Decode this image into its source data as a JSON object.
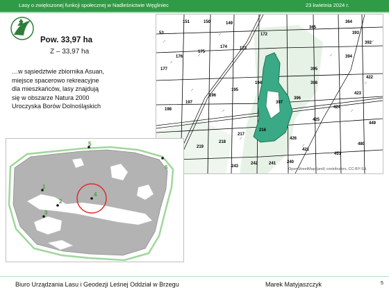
{
  "header": {
    "title": "Lasy o zwiększonej funkcji społecznej w Nadleśnictwie Węgliniec",
    "date": "23 kwietnia 2024 r."
  },
  "stats": {
    "area": "Pow. 33,97 ha",
    "sub_area": "Z – 33,97 ha"
  },
  "description": {
    "lines": [
      "…w sąsiedztwie zbiornika Asuan,",
      "miejsce spacerowo rekreacyjne",
      "dla mieszkańców, lasy znajdują",
      "się w obszarze Natura 2000",
      "Uroczyska Borów Dolnośląskich"
    ]
  },
  "forest_map": {
    "compartments": [
      "151",
      "150",
      "149",
      "172",
      "365",
      "364",
      "393",
      "176",
      "175",
      "174",
      "173",
      "394",
      "392",
      "177",
      "422",
      "395",
      "398",
      "194",
      "195",
      "196",
      "197",
      "198",
      "396",
      "423",
      "397",
      "424",
      "425",
      "217",
      "216",
      "218",
      "219",
      "426",
      "243",
      "242",
      "241",
      "240",
      "421",
      "451",
      "480",
      "449",
      "53"
    ],
    "credit": "OpenStreetMap (and) contributors, CC-BY-SA",
    "colors": {
      "highlight": "#3aa985",
      "highlight_edge": "#1f6f55",
      "wetland": "#e6f2e6"
    }
  },
  "overview_map": {
    "markers": [
      "5",
      "6",
      "4",
      "1",
      "2",
      "3"
    ],
    "colors": {
      "land": "#b3b3b3",
      "circle": "#e22a2a",
      "marker_label": "#35a832",
      "boundary": "#9fd79a"
    }
  },
  "footer": {
    "org": "Biuro Urządzania Lasu i Geodezji Leśnej Oddział w Brzegu",
    "author": "Marek Matyjaszczyk",
    "page_number": "5"
  }
}
